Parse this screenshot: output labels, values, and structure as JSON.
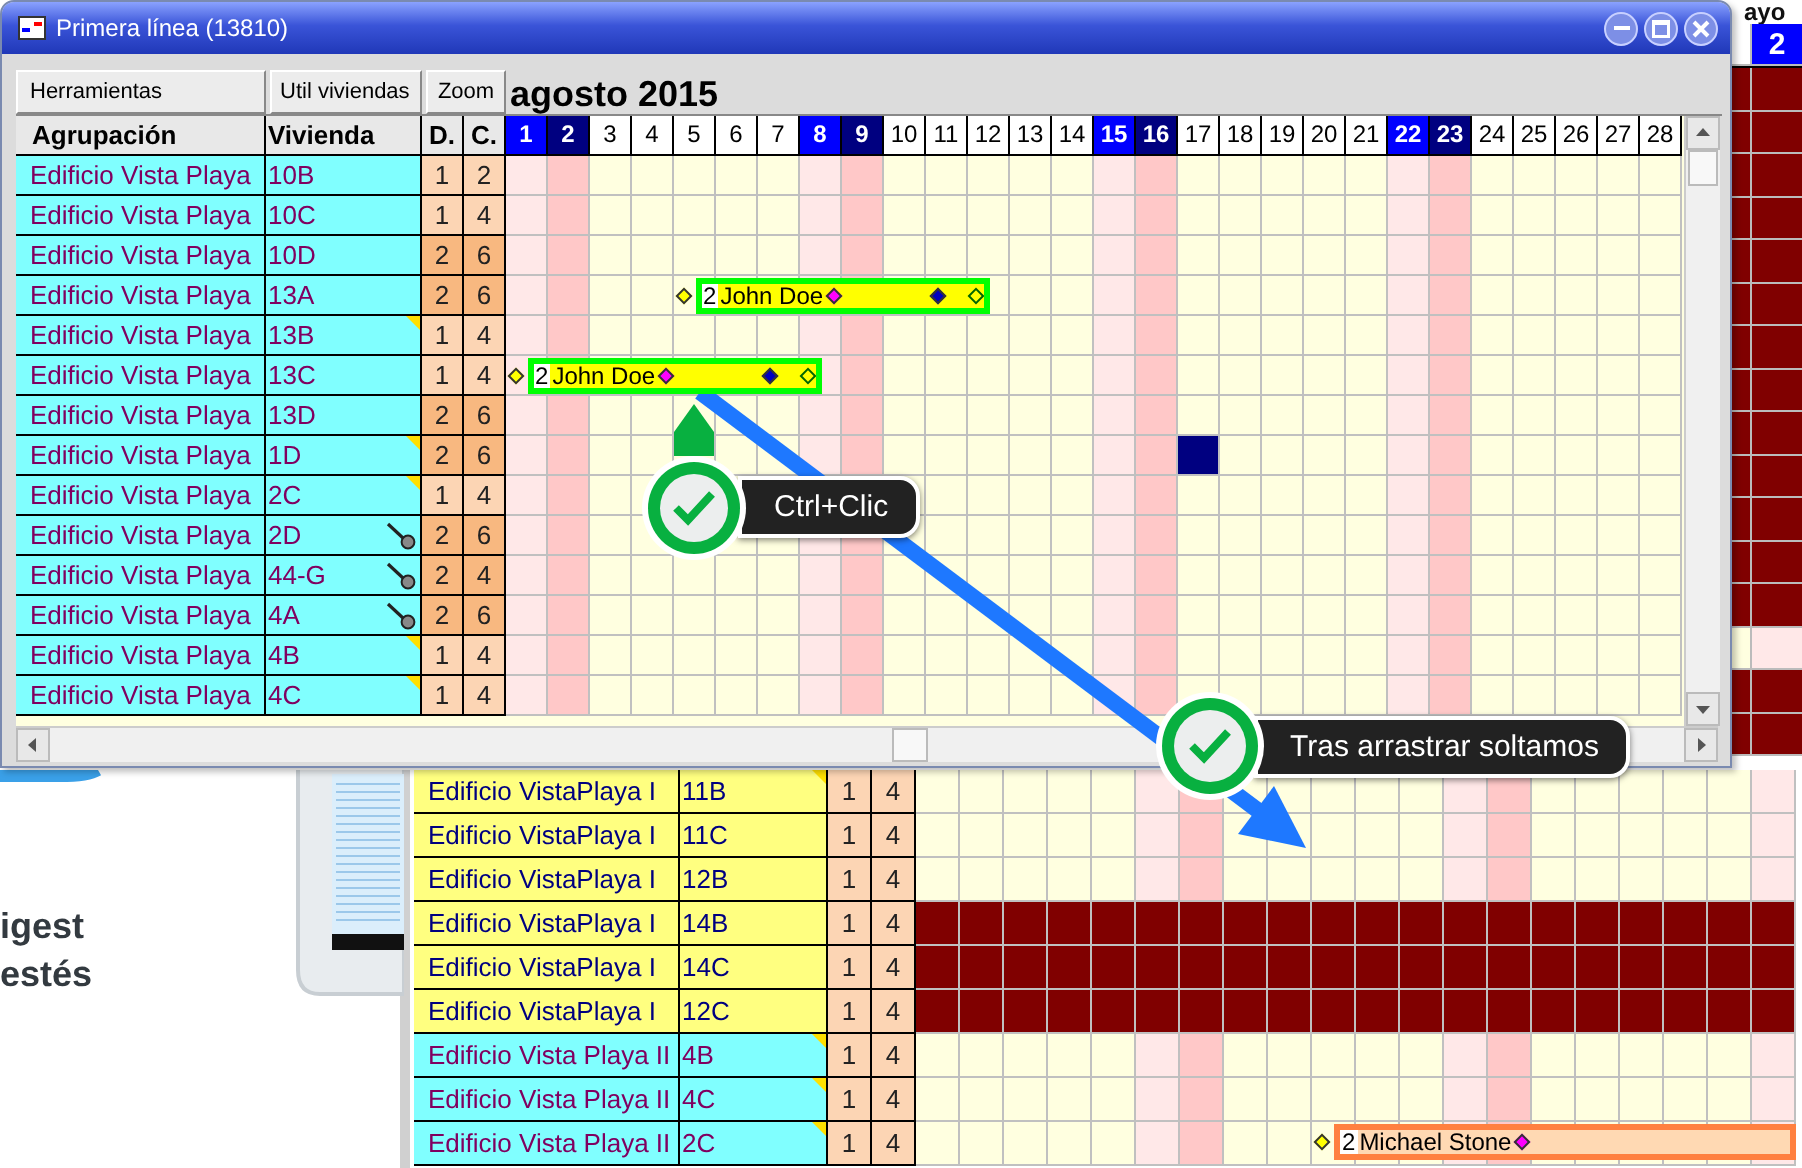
{
  "window": {
    "title": "Primera línea (13810)",
    "toolbar": [
      {
        "label": "Herramientas"
      },
      {
        "label": "Util viviendas"
      },
      {
        "label": "Zoom"
      }
    ],
    "month": "agosto 2015",
    "columns": [
      "Agrupación",
      "Vivienda",
      "D.",
      "C."
    ],
    "days": [
      {
        "label": "1",
        "kind": "saturday"
      },
      {
        "label": "2",
        "kind": "sunday"
      },
      {
        "label": "3",
        "kind": "weekday"
      },
      {
        "label": "4",
        "kind": "weekday"
      },
      {
        "label": "5",
        "kind": "weekday"
      },
      {
        "label": "6",
        "kind": "weekday"
      },
      {
        "label": "7",
        "kind": "weekday"
      },
      {
        "label": "8",
        "kind": "saturday"
      },
      {
        "label": "9",
        "kind": "sunday"
      },
      {
        "label": "10",
        "kind": "weekday"
      },
      {
        "label": "11",
        "kind": "weekday"
      },
      {
        "label": "12",
        "kind": "weekday"
      },
      {
        "label": "13",
        "kind": "weekday"
      },
      {
        "label": "14",
        "kind": "weekday"
      },
      {
        "label": "15",
        "kind": "saturday"
      },
      {
        "label": "16",
        "kind": "sunday"
      },
      {
        "label": "17",
        "kind": "weekday"
      },
      {
        "label": "18",
        "kind": "weekday"
      },
      {
        "label": "19",
        "kind": "weekday"
      },
      {
        "label": "20",
        "kind": "weekday"
      },
      {
        "label": "21",
        "kind": "weekday"
      },
      {
        "label": "22",
        "kind": "saturday"
      },
      {
        "label": "23",
        "kind": "sunday"
      },
      {
        "label": "24",
        "kind": "weekday"
      },
      {
        "label": "25",
        "kind": "weekday"
      },
      {
        "label": "26",
        "kind": "weekday"
      },
      {
        "label": "27",
        "kind": "weekday"
      },
      {
        "label": "28",
        "kind": "weekday"
      }
    ],
    "rows": [
      {
        "group": "Edificio Vista Playa",
        "unit": "10B",
        "d": "1",
        "c": "2",
        "kind": "small",
        "note": false,
        "key": false
      },
      {
        "group": "Edificio Vista Playa",
        "unit": "10C",
        "d": "1",
        "c": "4",
        "kind": "small",
        "note": false,
        "key": false
      },
      {
        "group": "Edificio Vista Playa",
        "unit": "10D",
        "d": "2",
        "c": "6",
        "kind": "large",
        "note": false,
        "key": false
      },
      {
        "group": "Edificio Vista Playa",
        "unit": "13A",
        "d": "2",
        "c": "6",
        "kind": "large",
        "note": false,
        "key": false,
        "bookings": [
          {
            "kind": "stay",
            "persons": "2",
            "name": "John Doe",
            "color": "#00ff00",
            "nights": [
              false,
              false,
              false,
              false,
              true,
              true,
              true,
              true,
              true,
              true,
              true,
              false,
              false,
              false,
              false,
              false,
              false,
              false,
              false,
              false,
              false,
              false,
              false,
              false,
              false,
              false,
              false,
              false
            ]
          }
        ]
      },
      {
        "group": "Edificio Vista Playa",
        "unit": "13B",
        "d": "1",
        "c": "4",
        "kind": "small",
        "note": true,
        "key": false
      },
      {
        "group": "Edificio Vista Playa",
        "unit": "13C",
        "d": "1",
        "c": "4",
        "kind": "small",
        "note": false,
        "key": false,
        "bookings": [
          {
            "kind": "stay",
            "persons": "2",
            "name": "John Doe",
            "color": "#00ff00",
            "nights": [
              true,
              true,
              true,
              true,
              true,
              true,
              true,
              false,
              false,
              false,
              false,
              false,
              false,
              false,
              false,
              false,
              false,
              false,
              false,
              false,
              false,
              false,
              false,
              false,
              false,
              false,
              false,
              false
            ]
          }
        ]
      },
      {
        "group": "Edificio Vista Playa",
        "unit": "13D",
        "d": "2",
        "c": "6",
        "kind": "large",
        "note": false,
        "key": false
      },
      {
        "group": "Edificio Vista Playa",
        "unit": "1D",
        "d": "2",
        "c": "6",
        "kind": "large",
        "note": true,
        "key": false,
        "cells": [
          {
            "selected": false
          },
          {
            "selected": false
          },
          {
            "selected": false
          },
          {
            "selected": false
          },
          {
            "selected": false
          },
          {
            "selected": false
          },
          {
            "selected": false
          },
          {
            "selected": false
          },
          {
            "selected": false
          },
          {
            "selected": false
          },
          {
            "selected": false
          },
          {
            "selected": false
          },
          {
            "selected": false
          },
          {
            "selected": false
          },
          {
            "selected": false
          },
          {
            "selected": false
          },
          {
            "selected": true
          },
          {
            "selected": false
          },
          {
            "selected": false
          },
          {
            "selected": false
          },
          {
            "selected": false
          },
          {
            "selected": false
          },
          {
            "selected": false
          },
          {
            "selected": false
          },
          {
            "selected": false
          },
          {
            "selected": false
          },
          {
            "selected": false
          },
          {
            "selected": false
          }
        ]
      },
      {
        "group": "Edificio Vista Playa",
        "unit": "2C",
        "d": "1",
        "c": "4",
        "kind": "small",
        "note": true,
        "key": false
      },
      {
        "group": "Edificio Vista Playa",
        "unit": "2D",
        "d": "2",
        "c": "6",
        "kind": "large",
        "note": false,
        "key": true
      },
      {
        "group": "Edificio Vista Playa",
        "unit": "44-G",
        "d": "2",
        "c": "4",
        "kind": "large",
        "note": false,
        "key": true
      },
      {
        "group": "Edificio Vista Playa",
        "unit": "4A",
        "d": "2",
        "c": "6",
        "kind": "large",
        "note": false,
        "key": true
      },
      {
        "group": "Edificio Vista Playa",
        "unit": "4B",
        "d": "1",
        "c": "4",
        "kind": "small",
        "note": true,
        "key": false
      },
      {
        "group": "Edificio Vista Playa",
        "unit": "4C",
        "d": "1",
        "c": "4",
        "kind": "small",
        "note": true,
        "key": false
      }
    ]
  },
  "background": {
    "heading": "ayo",
    "header_day": {
      "label": "2",
      "kind": "saturday"
    },
    "strip": [
      {
        "occupied": true
      },
      {
        "occupied": true
      },
      {
        "occupied": true
      },
      {
        "occupied": true
      },
      {
        "occupied": true
      },
      {
        "occupied": true
      },
      {
        "occupied": true
      },
      {
        "occupied": true
      },
      {
        "occupied": true
      },
      {
        "occupied": true
      },
      {
        "occupied": true
      },
      {
        "occupied": true
      },
      {
        "occupied": true
      },
      {
        "occupied": false
      },
      {
        "occupied": true
      },
      {
        "occupied": true
      }
    ],
    "promo": [
      "igest",
      "estés"
    ],
    "day_columns": [
      {
        "kind": "weekday"
      },
      {
        "kind": "weekday"
      },
      {
        "kind": "weekday"
      },
      {
        "kind": "weekday"
      },
      {
        "kind": "weekday"
      },
      {
        "kind": "saturday"
      },
      {
        "kind": "sunday"
      },
      {
        "kind": "weekday"
      },
      {
        "kind": "weekday"
      },
      {
        "kind": "weekday"
      },
      {
        "kind": "weekday"
      },
      {
        "kind": "weekday"
      },
      {
        "kind": "saturday"
      },
      {
        "kind": "sunday"
      },
      {
        "kind": "weekday"
      },
      {
        "kind": "weekday"
      },
      {
        "kind": "weekday"
      },
      {
        "kind": "weekday"
      },
      {
        "kind": "weekday"
      },
      {
        "kind": "saturday"
      }
    ],
    "rows": [
      {
        "group": "Edificio VistaPlaya I",
        "unit": "11B",
        "d": "1",
        "c": "4",
        "kind": "group-a",
        "note": true,
        "occupied": false
      },
      {
        "group": "Edificio VistaPlaya I",
        "unit": "11C",
        "d": "1",
        "c": "4",
        "kind": "group-a",
        "note": false,
        "occupied": false
      },
      {
        "group": "Edificio VistaPlaya I",
        "unit": "12B",
        "d": "1",
        "c": "4",
        "kind": "group-a",
        "note": false,
        "occupied": false
      },
      {
        "group": "Edificio VistaPlaya I",
        "unit": "14B",
        "d": "1",
        "c": "4",
        "kind": "group-a",
        "note": false,
        "occupied": true
      },
      {
        "group": "Edificio VistaPlaya I",
        "unit": "14C",
        "d": "1",
        "c": "4",
        "kind": "group-a",
        "note": false,
        "occupied": true
      },
      {
        "group": "Edificio VistaPlaya I",
        "unit": "12C",
        "d": "1",
        "c": "4",
        "kind": "group-a",
        "note": false,
        "occupied": true
      },
      {
        "group": "Edificio Vista Playa II",
        "unit": "4B",
        "d": "1",
        "c": "4",
        "kind": "group-b",
        "note": true,
        "occupied": false
      },
      {
        "group": "Edificio Vista Playa II",
        "unit": "4C",
        "d": "1",
        "c": "4",
        "kind": "group-b",
        "note": true,
        "occupied": false
      },
      {
        "group": "Edificio Vista Playa II",
        "unit": "2C",
        "d": "1",
        "c": "4",
        "kind": "group-b",
        "note": true,
        "occupied": false,
        "bookings": [
          {
            "kind": "stay",
            "persons": "2",
            "name": "Michael Stone",
            "color": "#ff8040",
            "nights": [
              false,
              false,
              false,
              false,
              false,
              false,
              false,
              false,
              false,
              true,
              true,
              true,
              true,
              true,
              true,
              true,
              true,
              true,
              true,
              true
            ]
          }
        ]
      }
    ]
  },
  "callouts": [
    {
      "text": "Ctrl+Clic"
    },
    {
      "text": "Tras arrastrar soltamos"
    }
  ]
}
